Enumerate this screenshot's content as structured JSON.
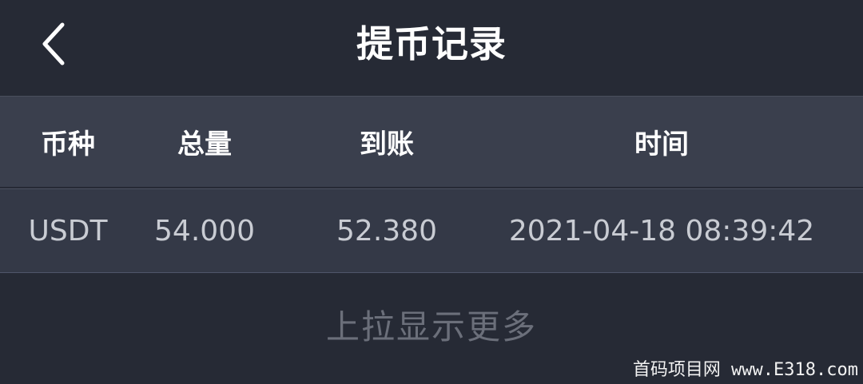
{
  "header": {
    "title": "提币记录",
    "back_icon": "chevron-left-icon"
  },
  "table": {
    "columns": [
      "币种",
      "总量",
      "到账",
      "时间"
    ],
    "rows": [
      {
        "coin": "USDT",
        "total": "54.000",
        "received": "52.380",
        "time": "2021-04-18 08:39:42"
      }
    ]
  },
  "footer": {
    "load_more": "上拉显示更多"
  },
  "watermark": {
    "text": "首码项目网 www.E318.com"
  },
  "colors": {
    "background": "#262a35",
    "header_row": "#3a3f4d",
    "data_row": "#343947",
    "title_text": "#ffffff",
    "data_text": "#c9ccd3",
    "muted_text": "#6b6f7a"
  }
}
